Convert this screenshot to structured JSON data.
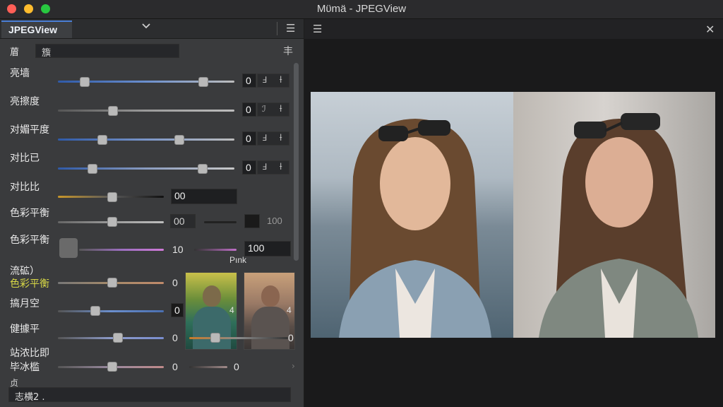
{
  "window": {
    "title": "Mϋmä - JPEGView"
  },
  "sidebar": {
    "tab_label": "JPEGView",
    "search": {
      "icon_label": "葿",
      "value": "籏",
      "pin_glyph": "丰"
    },
    "rows": [
      {
        "label": "亮墙",
        "value": "0",
        "step_a": "Ⅎ",
        "step_b": "ƚ"
      },
      {
        "label": "亮擦度",
        "value": "0",
        "step_a": "ℐ",
        "step_b": "ƚ"
      },
      {
        "label": "对媚平度",
        "value": "0",
        "step_a": "Ⅎ",
        "step_b": "ƚ"
      },
      {
        "label": "对比已",
        "value": "0",
        "step_a": "Ⅎ",
        "step_b": "ƚ"
      },
      {
        "label": "对比比",
        "value": "00"
      },
      {
        "label": "色彩平衡",
        "value": "00",
        "value2": "100"
      },
      {
        "label": "色彩平衡",
        "value": "10",
        "value2": "100",
        "extra": "Pınk"
      },
      {
        "label_top": "流砿）",
        "label": "色彩平衡",
        "value": "0"
      },
      {
        "label": "搞月空",
        "value": "0"
      },
      {
        "label": "健據平",
        "value": "0",
        "thumb_value": "0"
      },
      {
        "label_top": "站浓比即",
        "label": "毕冰槛",
        "value": "0",
        "value2": "0"
      }
    ],
    "thumb_badges": [
      "4",
      "4"
    ],
    "bottom": {
      "top_glyph": "贞",
      "value": "志横2 ."
    }
  },
  "icons": {
    "dropdown": "chevron-down-icon",
    "sidebar_menu": "hamburger-icon",
    "viewer_menu": "hamburger-icon",
    "close": "close-icon"
  },
  "colors": {
    "accent": "#4a7fd6",
    "panel": "#3a3b3d",
    "viewer_bg": "#1a1a1b"
  }
}
